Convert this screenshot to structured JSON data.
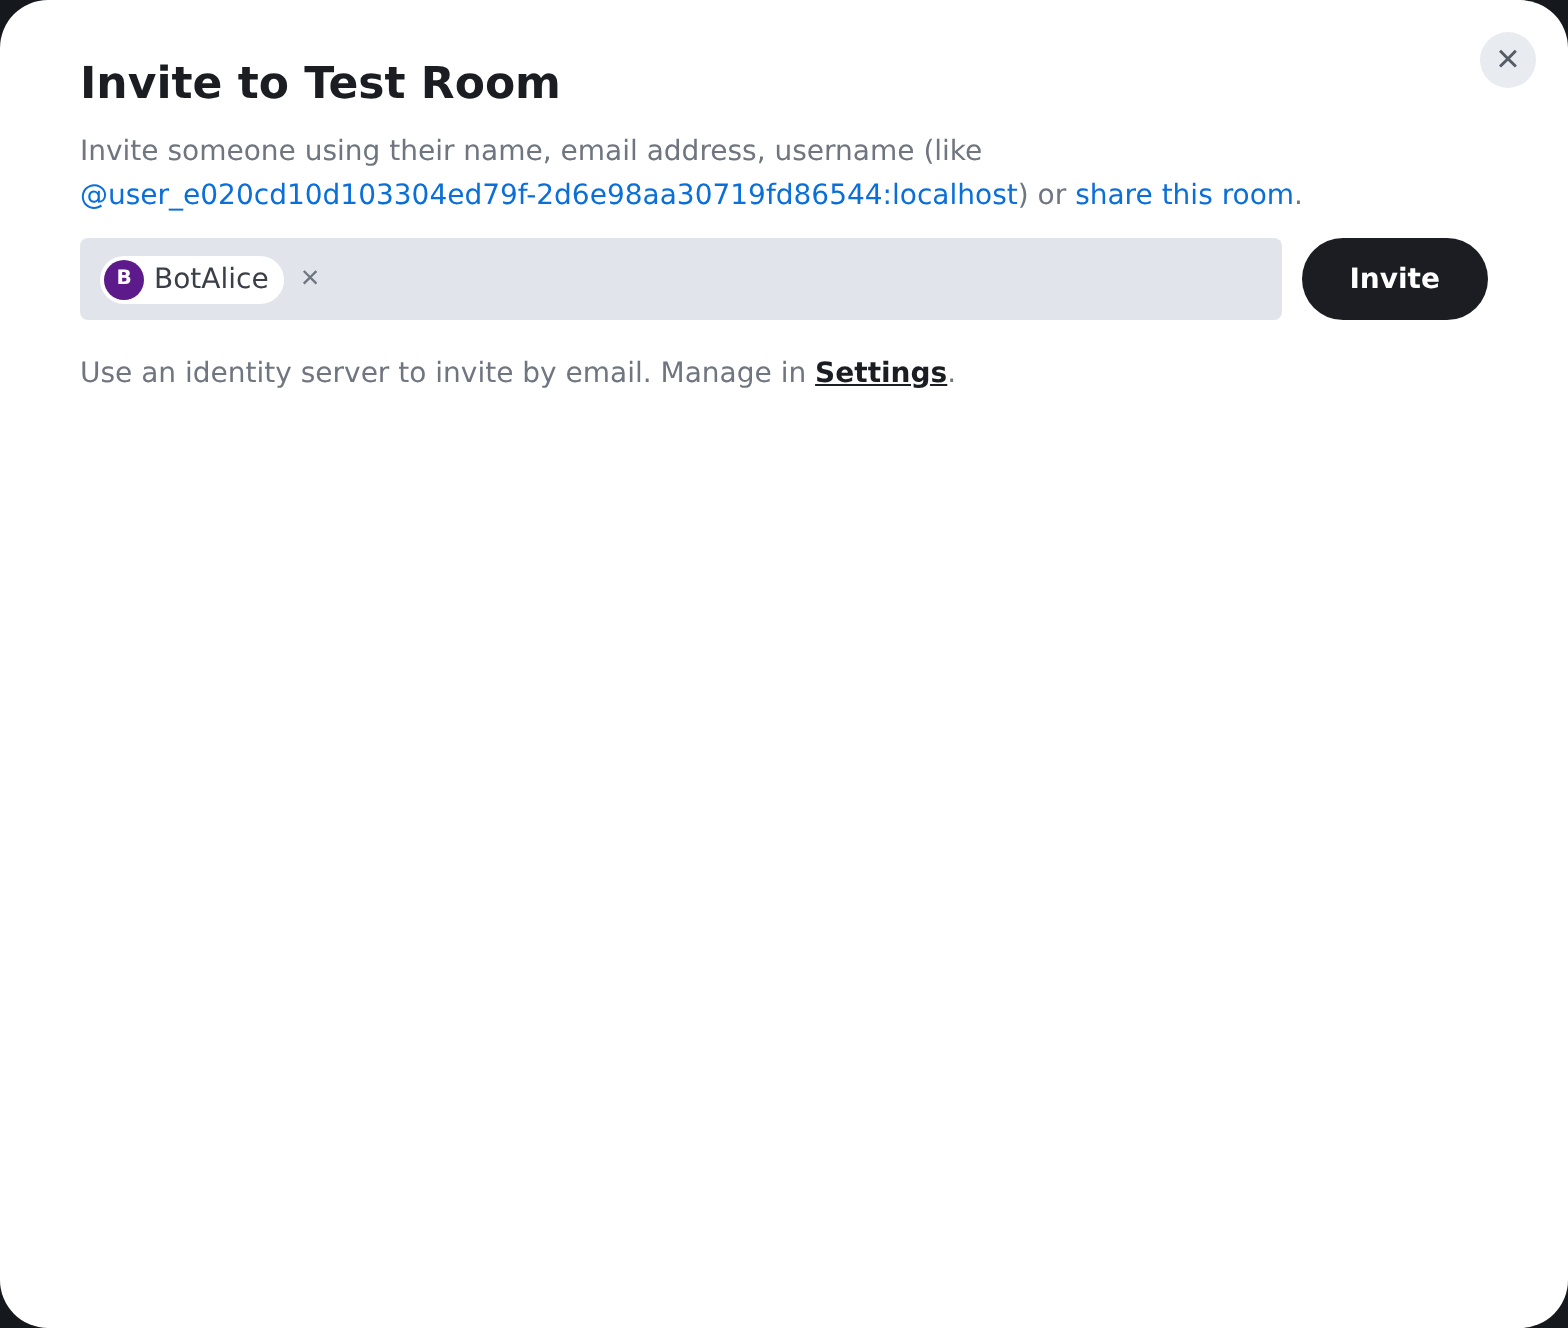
{
  "dialog": {
    "title": "Invite to Test Room",
    "close": "×",
    "description": [
      {
        "kind": "text",
        "text": "Invite someone using their name, email address, username (like "
      },
      {
        "kind": "link",
        "text": "@user_e020cd10d103304ed79f-2d6e98aa30719fd86544:localhost"
      },
      {
        "kind": "text",
        "text": ") or "
      },
      {
        "kind": "link",
        "text": "share this room"
      },
      {
        "kind": "text",
        "text": "."
      }
    ],
    "invitees": [
      {
        "initial": "B",
        "name": "BotAlice",
        "remove": "×",
        "color": "#5c1a8a"
      }
    ],
    "invite_button": "Invite",
    "footer": [
      {
        "kind": "text",
        "text": "Use an identity server to invite by email. Manage in "
      },
      {
        "kind": "strong-link",
        "text": "Settings"
      },
      {
        "kind": "text",
        "text": "."
      }
    ]
  }
}
